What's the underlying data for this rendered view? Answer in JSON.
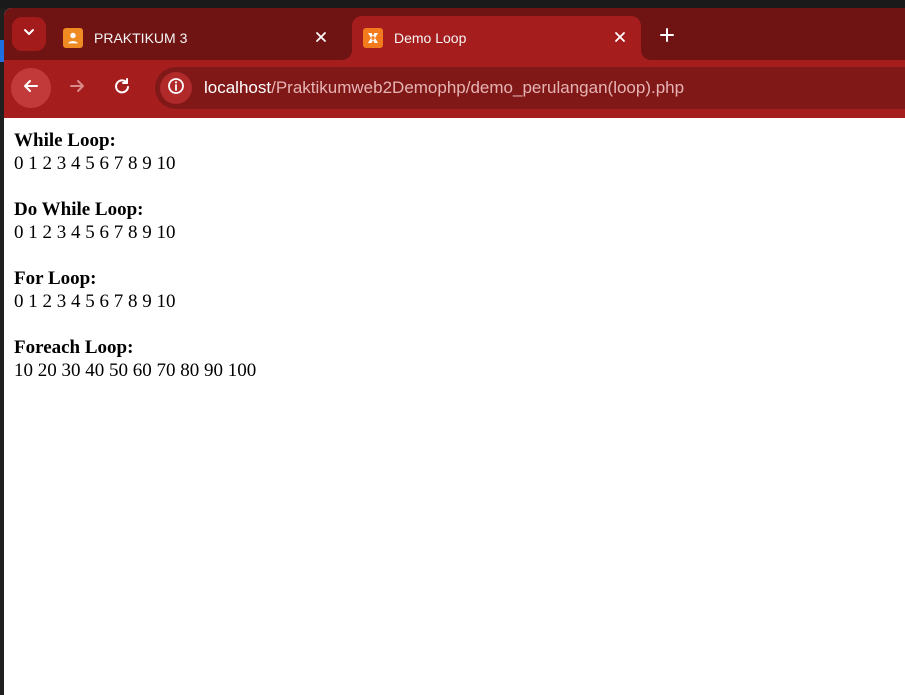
{
  "browser": {
    "tab_search_icon": "chevron-down-icon",
    "tabs": [
      {
        "label": "PRAKTIKUM 3",
        "favicon": "user-badge-icon",
        "favicon_color": "#f08b24",
        "active": false,
        "close_icon": "close-icon"
      },
      {
        "label": "Demo Loop",
        "favicon": "xampp-icon",
        "favicon_color": "#f27b1d",
        "active": true,
        "close_icon": "close-icon"
      }
    ],
    "new_tab_icon": "plus-icon",
    "toolbar": {
      "back_icon": "back-arrow-icon",
      "forward_icon": "forward-arrow-icon",
      "reload_icon": "reload-icon",
      "site_info_icon": "info-icon"
    },
    "address": {
      "host": "localhost",
      "path": "/Praktikumweb2Demophp/demo_perulangan(loop).php"
    },
    "colors": {
      "tabstrip": "#6f1313",
      "active_tab": "#a61d1d",
      "toolbar": "#a61d1d",
      "omnibox": "#811818",
      "back_button": "#c23a3a"
    }
  },
  "page": {
    "sections": [
      {
        "title": "While Loop:",
        "values": "0 1 2 3 4 5 6 7 8 9 10"
      },
      {
        "title": "Do While Loop:",
        "values": "0 1 2 3 4 5 6 7 8 9 10"
      },
      {
        "title": "For Loop:",
        "values": "0 1 2 3 4 5 6 7 8 9 10"
      },
      {
        "title": "Foreach Loop:",
        "values": "10 20 30 40 50 60 70 80 90 100"
      }
    ]
  }
}
